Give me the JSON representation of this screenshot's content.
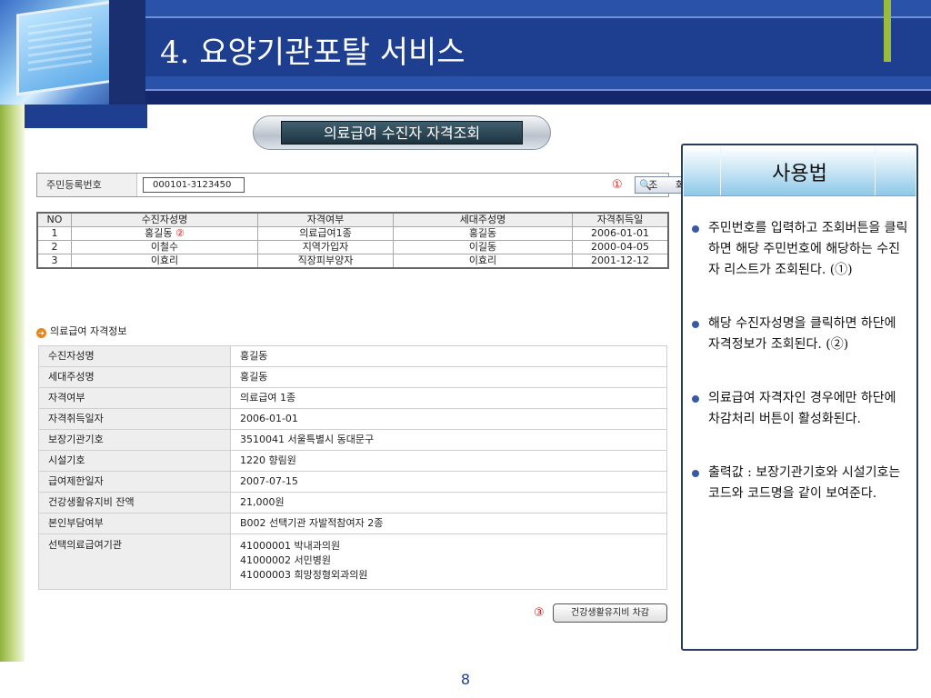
{
  "slide": {
    "title": "4. 요양기관포탈 서비스",
    "page_number": "8"
  },
  "screen_title": "의료급여 수진자 자격조회",
  "search": {
    "label": "주민등록번호",
    "value": "000101-3123450",
    "marker": "①",
    "button_label": "조 회"
  },
  "results": {
    "columns": [
      "NO",
      "수진자성명",
      "자격여부",
      "세대주성명",
      "자격취득일"
    ],
    "rows": [
      {
        "no": "1",
        "name": "홍길동",
        "marker": "②",
        "status": "의료급여1종",
        "head": "홍길동",
        "date": "2006-01-01"
      },
      {
        "no": "2",
        "name": "이철수",
        "marker": "",
        "status": "지역가입자",
        "head": "이길동",
        "date": "2000-04-05"
      },
      {
        "no": "3",
        "name": "이효리",
        "marker": "",
        "status": "직장피부양자",
        "head": "이효리",
        "date": "2001-12-12"
      }
    ]
  },
  "detail": {
    "section_title": "의료급여 자격정보",
    "rows": [
      {
        "label": "수진자성명",
        "value": "홍길동"
      },
      {
        "label": "세대주성명",
        "value": "홍길동"
      },
      {
        "label": "자격여부",
        "value": "의료급여 1종"
      },
      {
        "label": "자격취득일자",
        "value": "2006-01-01"
      },
      {
        "label": "보장기관기호",
        "value": "3510041  서울특별시 동대문구"
      },
      {
        "label": "시설기호",
        "value": "1220  향림원"
      },
      {
        "label": "급여제한일자",
        "value": "2007-07-15"
      },
      {
        "label": "건강생활유지비 잔액",
        "value": "21,000원"
      },
      {
        "label": "본인부담여부",
        "value": "B002  선택기관 자발적참여자 2종"
      }
    ],
    "institutions": {
      "label": "선택의료급여기관",
      "lines": [
        "41000001   박내과의원",
        "41000002   서민병원",
        "41000003   희망정형외과의원"
      ]
    }
  },
  "deduct": {
    "marker": "③",
    "button_label": "건강생활유지비 차감"
  },
  "usage": {
    "title": "사용법",
    "items": [
      "주민번호를 입력하고 조회버튼을 클릭하면 해당 주민번호에 해당하는 수진자 리스트가 조회된다. (①)",
      "해당 수진자성명을 클릭하면 하단에 자격정보가 조회된다. (②)",
      "의료급여 자격자인 경우에만 하단에 차감처리 버튼이 활성화된다.",
      "출력값 : 보장기관기호와 시설기호는 코드와 코드명을 같이 보여준다."
    ]
  }
}
